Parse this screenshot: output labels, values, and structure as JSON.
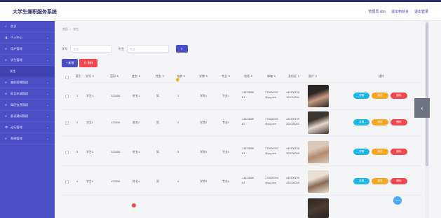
{
  "app_title": "大学生兼职服务系统",
  "top_links": {
    "user": "管理员 abo",
    "home": "退出到前台",
    "logout": "退出登录"
  },
  "sidebar": {
    "items": [
      {
        "icon": "home-icon",
        "glyph": "⌂",
        "label": "首页",
        "chevron": false
      },
      {
        "icon": "user-icon",
        "glyph": "♟",
        "label": "个人中心",
        "chevron": true
      },
      {
        "icon": "list-icon",
        "glyph": "≡",
        "label": "用户管理",
        "chevron": true
      },
      {
        "icon": "list-icon",
        "glyph": "≡",
        "label": "学生管理",
        "chevron": true
      }
    ],
    "sub_active": "学生",
    "items_after": [
      {
        "icon": "list-icon",
        "glyph": "≡",
        "label": "兼职招聘管理",
        "chevron": true
      },
      {
        "icon": "list-icon",
        "glyph": "≡",
        "label": "岗位申请管理",
        "chevron": true
      },
      {
        "icon": "list-icon",
        "glyph": "≡",
        "label": "简历信息管理",
        "chevron": true
      },
      {
        "icon": "list-icon",
        "glyph": "≡",
        "label": "面试通知管理",
        "chevron": true
      },
      {
        "icon": "gear-icon",
        "glyph": "⚙",
        "label": "论坛管理",
        "chevron": true
      },
      {
        "icon": "list-icon",
        "glyph": "≡",
        "label": "系统管理",
        "chevron": true
      }
    ]
  },
  "breadcrumb": {
    "home": "首页",
    "sep": "/",
    "current": "学生"
  },
  "search": {
    "label1": "学号",
    "placeholder1": "学号",
    "label2": "专业",
    "placeholder2": "专业",
    "button": "⌕"
  },
  "actions": {
    "add": "+ 新增",
    "delete": "⊖ 删除"
  },
  "table": {
    "headers": [
      "索引",
      "学号 ⇕",
      "密码 ⇕",
      "姓名 ⇕",
      "性别 ⇕",
      "年龄 ⇕",
      "学院 ⇕",
      "专业 ⇕",
      "电话 ⇕",
      "邮箱 ⇕",
      "身份证 ⇕",
      "照片 ⇕",
      "操作"
    ],
    "buttons": {
      "view": "详情",
      "edit": "修改",
      "remove": "删除"
    },
    "rows": [
      {
        "idx": "1",
        "sid": "学生1",
        "pwd": "123456",
        "name": "姓名1",
        "sex": "男",
        "age": "1",
        "college": "学院1",
        "major": "专业1",
        "phone": [
          "13823888",
          "81"
        ],
        "email": [
          "773890001",
          "@qq.com"
        ],
        "idcard": [
          "440300199",
          "101010001"
        ]
      },
      {
        "idx": "2",
        "sid": "学生2",
        "pwd": "123456",
        "name": "姓名2",
        "sex": "男",
        "age": "2",
        "college": "学院2",
        "major": "专业2",
        "phone": [
          "13823888",
          "82"
        ],
        "email": [
          "773890002",
          "@qq.com"
        ],
        "idcard": [
          "440300199",
          "202020002"
        ]
      },
      {
        "idx": "3",
        "sid": "学生3",
        "pwd": "123456",
        "name": "姓名3",
        "sex": "男",
        "age": "3",
        "college": "学院3",
        "major": "专业3",
        "phone": [
          "13823888",
          "83"
        ],
        "email": [
          "773890003",
          "@qq.com"
        ],
        "idcard": [
          "440300199",
          "303030003"
        ]
      },
      {
        "idx": "4",
        "sid": "学生4",
        "pwd": "123456",
        "name": "姓名4",
        "sex": "男",
        "age": "4",
        "college": "学院4",
        "major": "专业4",
        "phone": [
          "13823888",
          "84"
        ],
        "email": [
          "773890004",
          "@qq.com"
        ],
        "idcard": [
          "440300199",
          "404040004"
        ]
      }
    ]
  },
  "float_button": "Ami",
  "side_tab_glyph": "‹",
  "colors": {
    "sidebar": "#4b4fc6",
    "accent": "#4b4fc6",
    "danger": "#f0484e",
    "warning": "#f5a623",
    "info": "#1fb6e8"
  }
}
